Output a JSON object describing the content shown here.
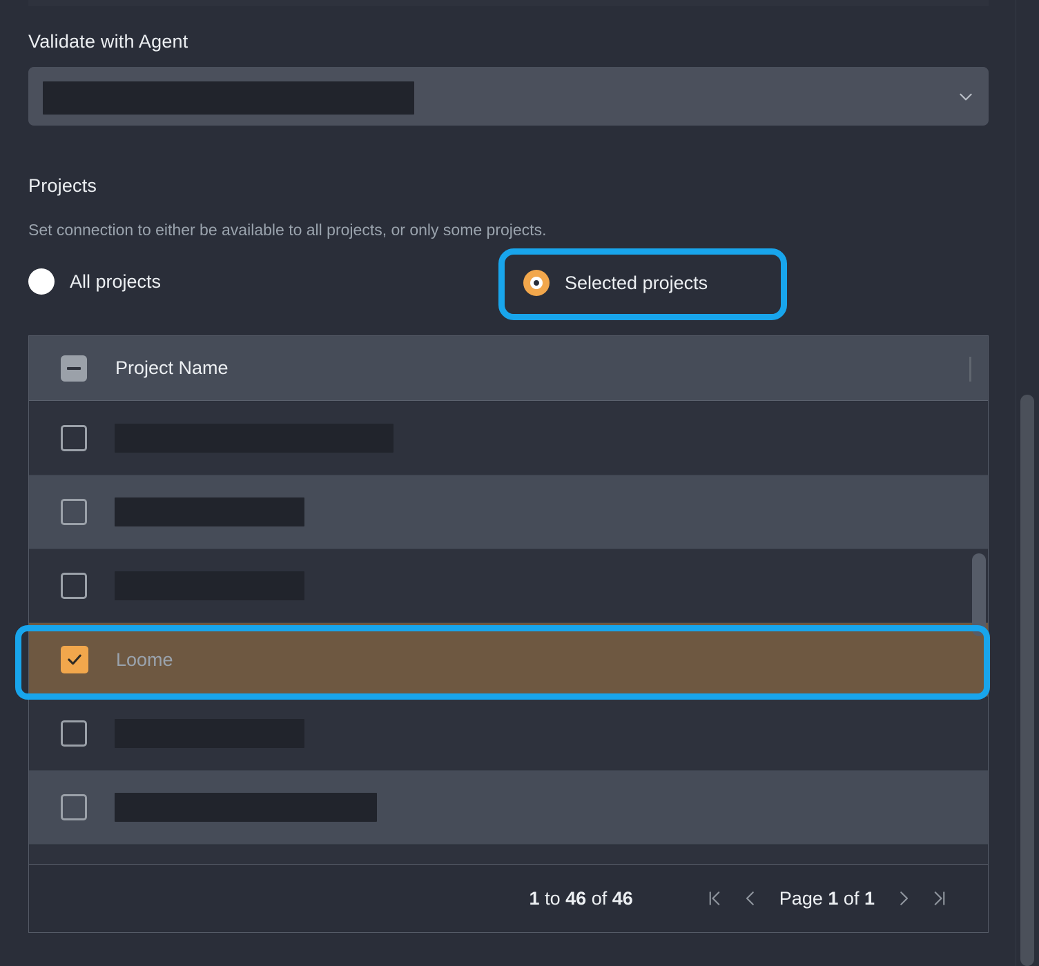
{
  "theme": {
    "background": "#2a2e39",
    "panel": "#464c58",
    "accent_orange": "#f2a74c",
    "annotation_blue": "#18a5ec",
    "selected_row": "#6e5841",
    "text_primary": "#eceff2",
    "text_muted": "#9aa3ad"
  },
  "validate": {
    "label": "Validate with Agent",
    "select_value": "",
    "select_value_redacted": true,
    "chevron_icon": "chevron-down-icon"
  },
  "projects": {
    "heading": "Projects",
    "description": "Set connection to either be available to all projects, or only some projects.",
    "options": [
      {
        "label": "All projects",
        "selected": false
      },
      {
        "label": "Selected projects",
        "selected": true,
        "annotated": true
      }
    ]
  },
  "table": {
    "header": {
      "select_all_state": "indeterminate",
      "select_all_icon": "indeterminate-checkbox-icon",
      "column_name": "Project Name"
    },
    "rows": [
      {
        "name": "",
        "redacted": true,
        "redact_width": 404,
        "checked": false,
        "stripe": "odd",
        "highlighted": false
      },
      {
        "name": "",
        "redacted": true,
        "redact_width": 275,
        "checked": false,
        "stripe": "even",
        "highlighted": false
      },
      {
        "name": "",
        "redacted": true,
        "redact_width": 275,
        "checked": false,
        "stripe": "odd",
        "highlighted": false
      },
      {
        "name": "Loome",
        "redacted": false,
        "redact_width": 0,
        "checked": true,
        "stripe": "sel",
        "highlighted": true
      },
      {
        "name": "",
        "redacted": true,
        "redact_width": 275,
        "checked": false,
        "stripe": "odd",
        "highlighted": false
      },
      {
        "name": "",
        "redacted": true,
        "redact_width": 380,
        "checked": false,
        "stripe": "even",
        "highlighted": false
      }
    ],
    "footer": {
      "range_prefix": "1",
      "range_to": "to",
      "range_end": "46",
      "range_of": "of",
      "range_total": "46",
      "page_word": "Page",
      "page_current": "1",
      "page_of": "of",
      "page_total": "1",
      "first_page_icon": "first-page-icon",
      "prev_page_icon": "previous-page-icon",
      "next_page_icon": "next-page-icon",
      "last_page_icon": "last-page-icon"
    }
  }
}
